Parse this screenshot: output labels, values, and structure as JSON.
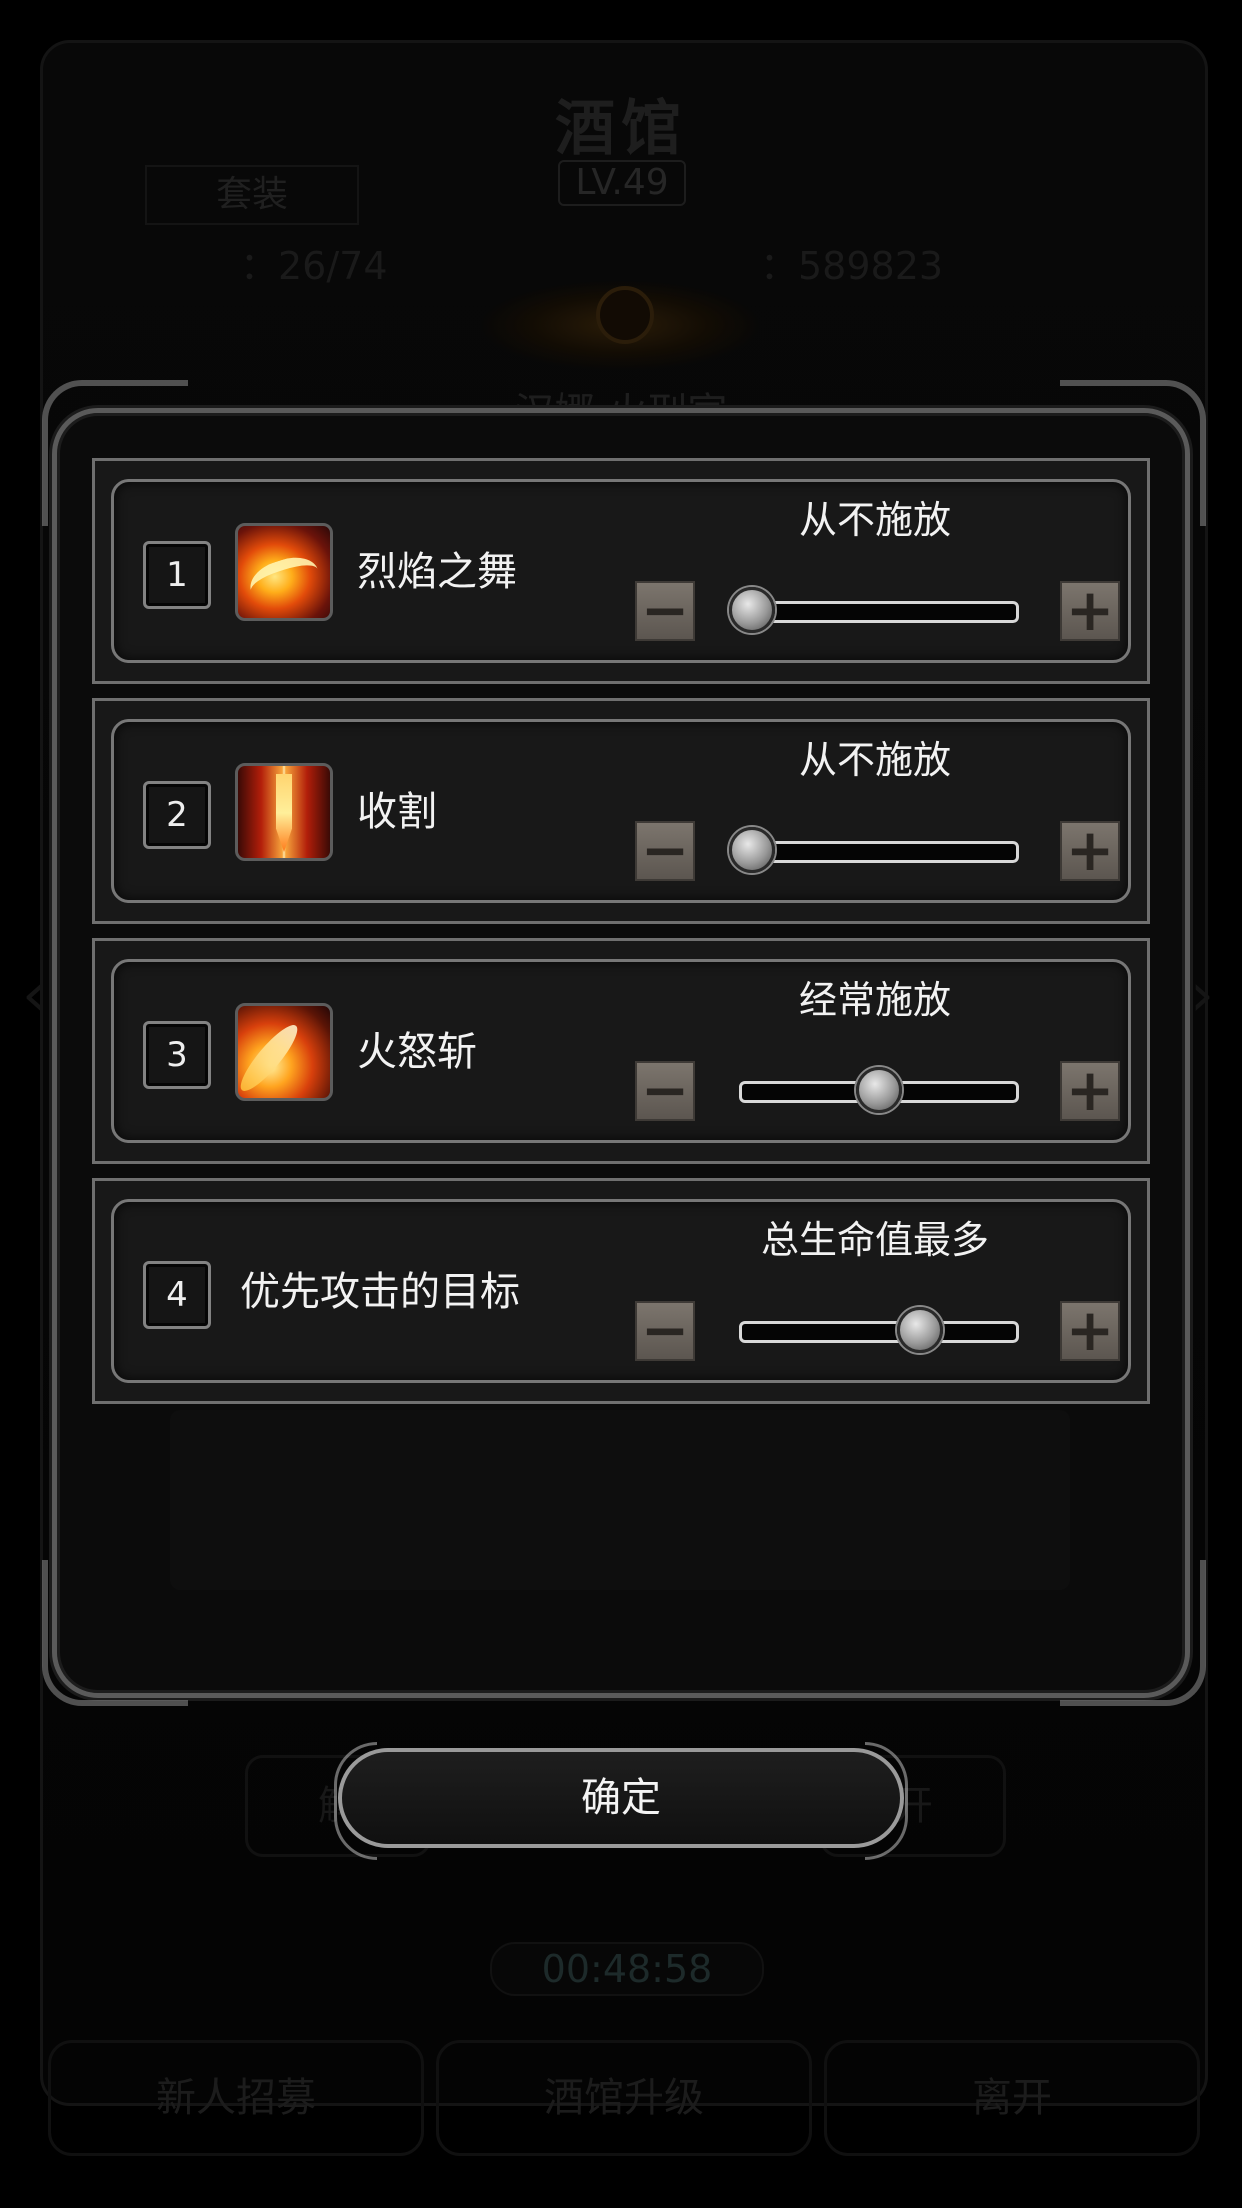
{
  "background": {
    "title": "酒馆",
    "level": "LV.49",
    "set_tab": "套装",
    "stat_left": "：26/74",
    "stat_right": "：589823",
    "hero_name": "汉娜 火刑官",
    "side_left": "解",
    "side_right": "开",
    "timer": "00:48:58",
    "bottom_buttons": [
      "新人招募",
      "酒馆升级",
      "离开"
    ]
  },
  "skills": [
    {
      "index": "1",
      "icon": "flame-dance-icon",
      "name": "烈焰之舞",
      "frequency": "从不施放",
      "level": 0.0
    },
    {
      "index": "2",
      "icon": "reap-icon",
      "name": "收割",
      "frequency": "从不施放",
      "level": 0.0
    },
    {
      "index": "3",
      "icon": "fire-fury-slash-icon",
      "name": "火怒斩",
      "frequency": "经常施放",
      "level": 0.5
    }
  ],
  "target": {
    "index": "4",
    "name": "优先攻击的目标",
    "value": "总生命值最多",
    "level": 0.66
  },
  "confirm_label": "确定",
  "colors": {
    "panel_bg": "#181818",
    "border": "#6f6f6f",
    "stepper": "#6d665f",
    "text": "#f2f2f2"
  }
}
